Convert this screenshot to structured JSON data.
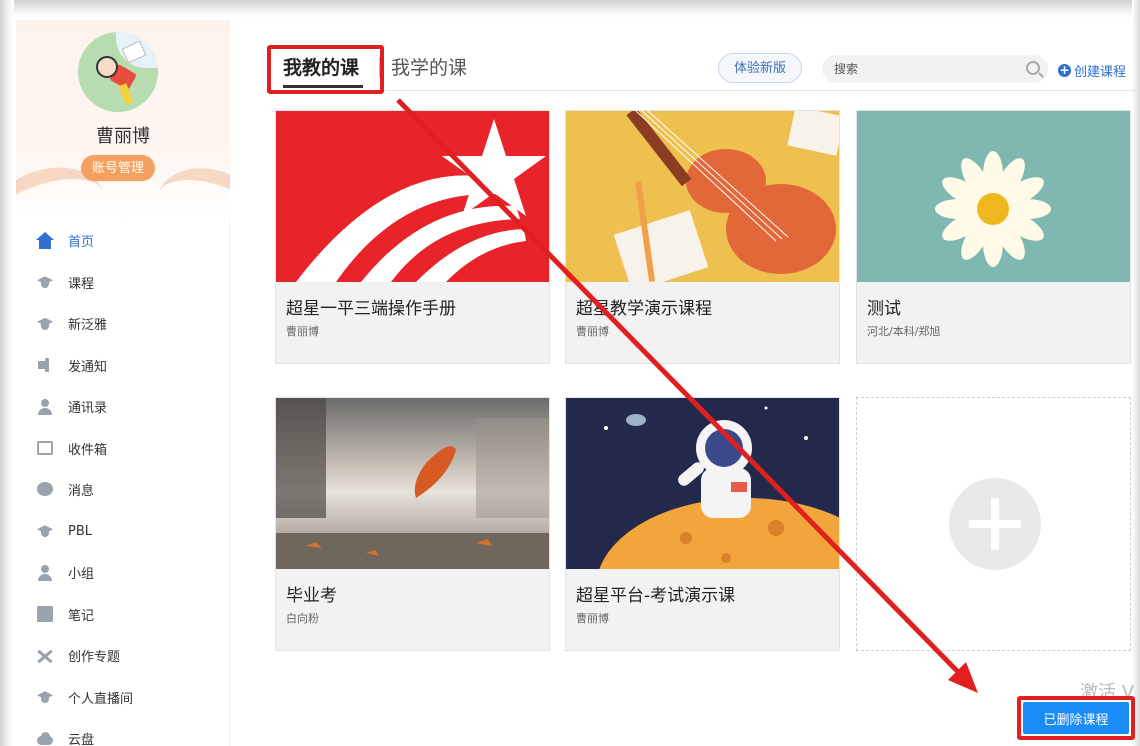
{
  "profile": {
    "name": "曹丽博",
    "account_label": "账号管理"
  },
  "nav": {
    "items": [
      {
        "label": "首页",
        "icon": "home-icon",
        "active": true
      },
      {
        "label": "课程",
        "icon": "graduation-cap-icon"
      },
      {
        "label": "新泛雅",
        "icon": "graduation-cap-icon"
      },
      {
        "label": "发通知",
        "icon": "speaker-icon"
      },
      {
        "label": "通讯录",
        "icon": "contacts-icon"
      },
      {
        "label": "收件箱",
        "icon": "inbox-icon"
      },
      {
        "label": "消息",
        "icon": "chat-bubble-icon"
      },
      {
        "label": "PBL",
        "icon": "graduation-cap-icon"
      },
      {
        "label": "小组",
        "icon": "person-icon"
      },
      {
        "label": "笔记",
        "icon": "note-icon"
      },
      {
        "label": "创作专题",
        "icon": "scissors-icon"
      },
      {
        "label": "个人直播间",
        "icon": "graduation-cap-icon"
      },
      {
        "label": "云盘",
        "icon": "cloud-icon"
      }
    ]
  },
  "tabs": {
    "teaching": "我教的课",
    "learning": "我学的课"
  },
  "toolbar": {
    "trial_label": "体验新版",
    "search_placeholder": "搜索",
    "create_label": "创建课程"
  },
  "courses": [
    {
      "title": "超星一平三端操作手册",
      "author": "曹丽博"
    },
    {
      "title": "超星教学演示课程",
      "author": "曹丽博"
    },
    {
      "title": "测试",
      "author": "河北/本科/郑旭"
    },
    {
      "title": "毕业考",
      "author": "白向粉"
    },
    {
      "title": "超星平台-考试演示课",
      "author": "曹丽博"
    }
  ],
  "footer": {
    "deleted_label": "已删除课程",
    "watermark": "激活 V"
  },
  "colors": {
    "accent": "#2e6fcf",
    "annotation_red": "#e02020",
    "button_blue": "#1a8cf5"
  }
}
